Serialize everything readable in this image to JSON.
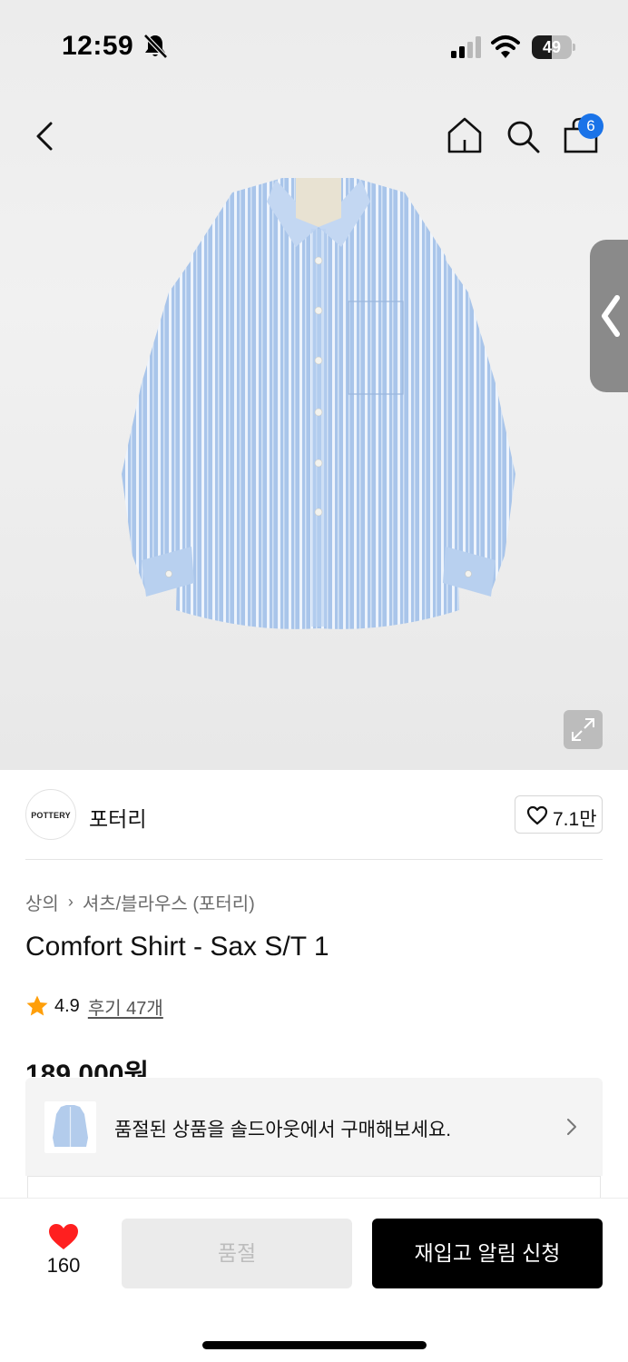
{
  "status_bar": {
    "time": "12:59",
    "battery_level": "49",
    "battery_fraction": 0.49,
    "icons": [
      "bell-off-icon",
      "cellular-signal-icon",
      "wifi-icon",
      "battery-icon"
    ]
  },
  "nav": {
    "icons": [
      "back-icon",
      "home-icon",
      "search-icon",
      "shopping-bag-icon"
    ],
    "cart_count": "6",
    "badge_color": "#1a73e8"
  },
  "product": {
    "image_alt_icon": "striped-shirt-image",
    "brand_logo_text": "POTTERY",
    "brand_name": "포터리",
    "like_count": "7.1만",
    "breadcrumb": [
      "상의",
      "셔츠/블라우스 (포터리)"
    ],
    "title": "Comfort Shirt - Sax S/T 1",
    "rating": "4.9",
    "review_link": "후기 47개",
    "price": "189,000원"
  },
  "soldout_banner": {
    "text": "품절된 상품을 솔드아웃에서 구매해보세요."
  },
  "bottom_bar": {
    "wish_count": "160",
    "soldout_label": "품절",
    "restock_label": "재입고 알림 신청",
    "heart_color": "#ff1f1f",
    "star_color": "#ff9f0a"
  }
}
